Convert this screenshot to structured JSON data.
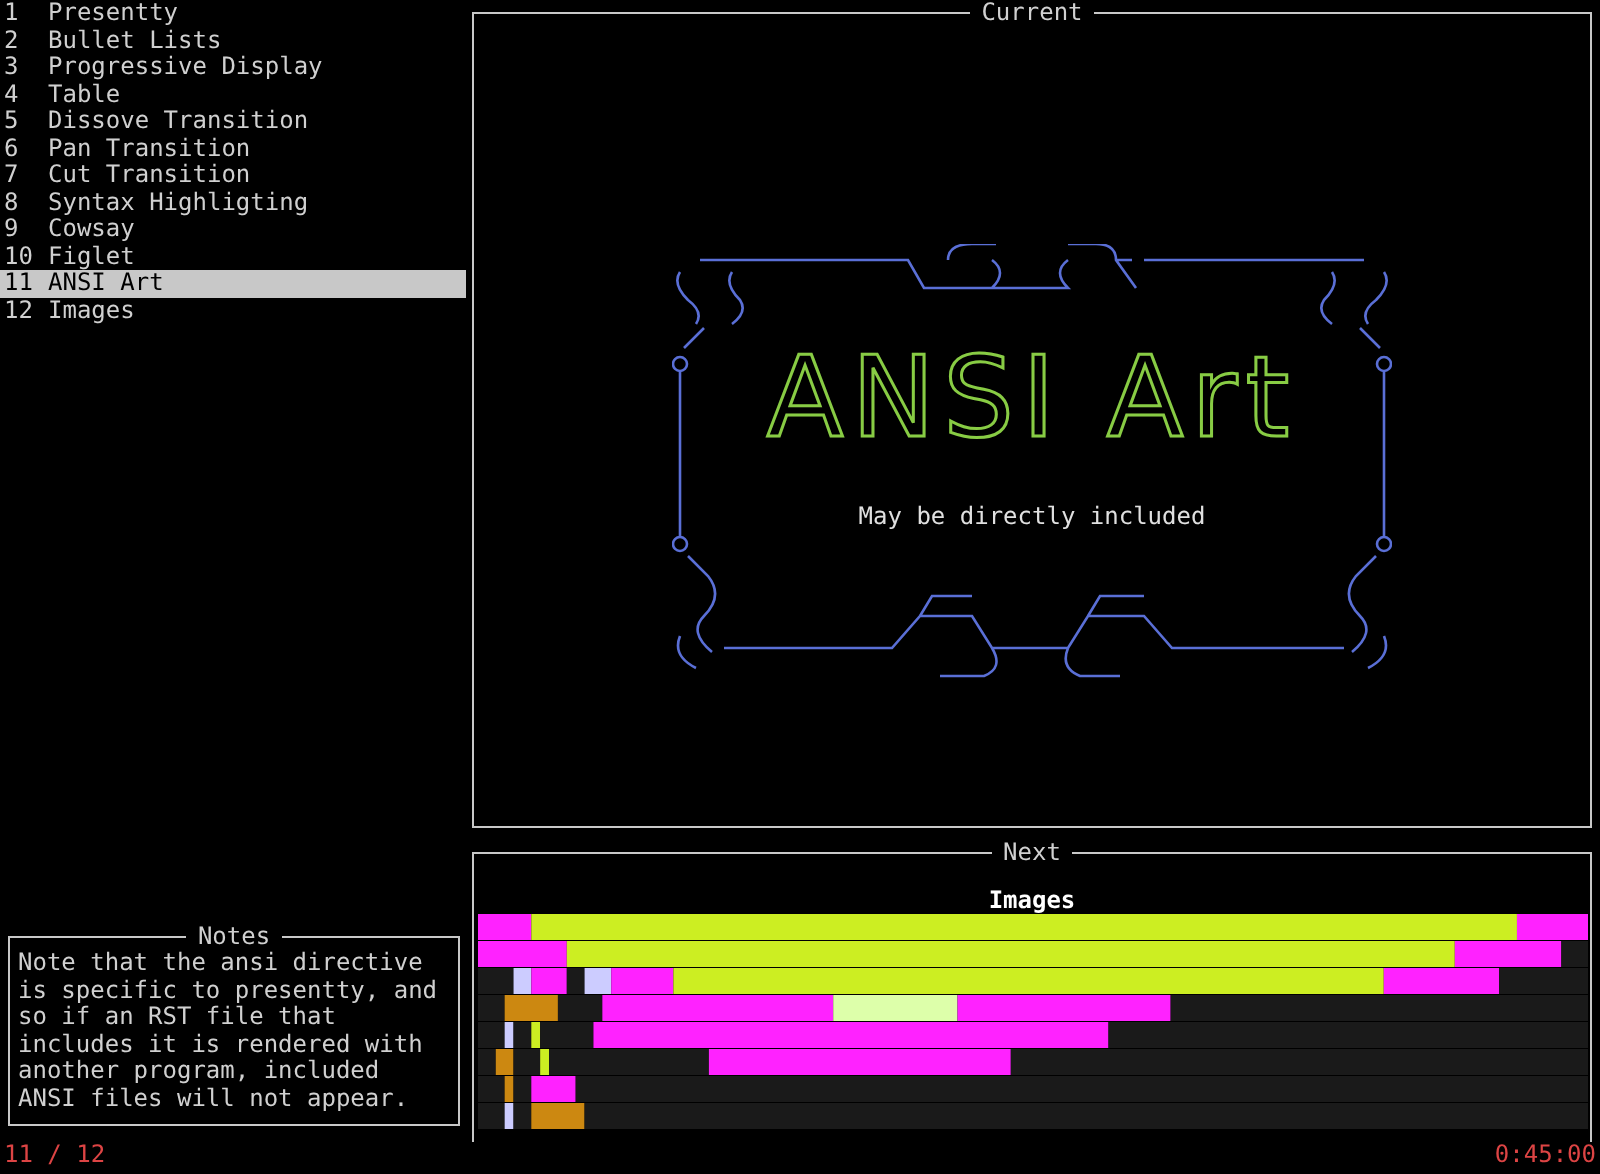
{
  "slides": [
    {
      "number": "1",
      "title": "Presentty",
      "selected": false
    },
    {
      "number": "2",
      "title": "Bullet Lists",
      "selected": false
    },
    {
      "number": "3",
      "title": "Progressive Display",
      "selected": false
    },
    {
      "number": "4",
      "title": "Table",
      "selected": false
    },
    {
      "number": "5",
      "title": "Dissove Transition",
      "selected": false
    },
    {
      "number": "6",
      "title": "Pan Transition",
      "selected": false
    },
    {
      "number": "7",
      "title": "Cut Transition",
      "selected": false
    },
    {
      "number": "8",
      "title": "Syntax Highligting",
      "selected": false
    },
    {
      "number": "9",
      "title": "Cowsay",
      "selected": false
    },
    {
      "number": "10",
      "title": "Figlet",
      "selected": false
    },
    {
      "number": "11",
      "title": "ANSI Art",
      "selected": true
    },
    {
      "number": "12",
      "title": "Images",
      "selected": false
    }
  ],
  "current": {
    "title": "Current",
    "banner": "ANSI Art",
    "caption": "May be directly included"
  },
  "next": {
    "title": "Next",
    "heading": "Images"
  },
  "notes": {
    "title": "Notes",
    "text": "Note that the ansi directive is specific to presentty, and so if an RST file that includes it is rendered with another program, included ANSI files will not appear."
  },
  "status_bar": {
    "position": "11 / 12",
    "time": "0:45:00"
  }
}
